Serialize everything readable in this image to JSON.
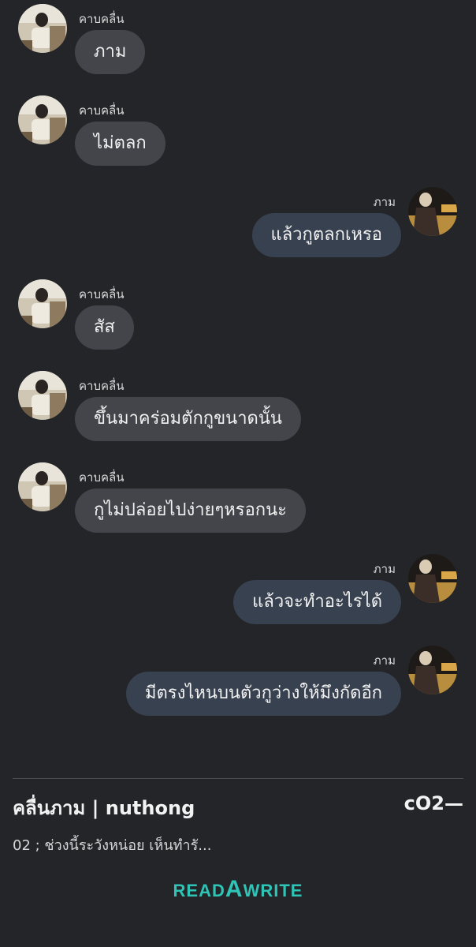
{
  "conversation": {
    "messages": [
      {
        "side": "left",
        "sender": "คาบคลื่น",
        "text": "ภาม"
      },
      {
        "side": "left",
        "sender": "คาบคลื่น",
        "text": "ไม่ตลก"
      },
      {
        "side": "right",
        "sender": "ภาม",
        "text": "แล้วกูตลกเหรอ"
      },
      {
        "side": "left",
        "sender": "คาบคลื่น",
        "text": "สัส"
      },
      {
        "side": "left",
        "sender": "คาบคลื่น",
        "text": "ขึ้นมาคร่อมตักกูขนาดนั้น"
      },
      {
        "side": "left",
        "sender": "คาบคลื่น",
        "text": "กูไม่ปล่อยไปง่ายๆหรอกนะ"
      },
      {
        "side": "right",
        "sender": "ภาม",
        "text": "แล้วจะทำอะไรได้"
      },
      {
        "side": "right",
        "sender": "ภาม",
        "text": "มีตรงไหนบนตัวกูว่างให้มึงกัดอีก"
      }
    ]
  },
  "footer": {
    "story_title": "คลื่นภาม | nuthong",
    "chapter_code": "cO2—",
    "chapter_title": "02 ; ช่วงนี้ระวังหน่อย เห็นทำรั...",
    "logo_pre": "READ",
    "logo_big": "A",
    "logo_post": "WRITE"
  },
  "colors": {
    "background": "#232529",
    "bubble_left": "#43454b",
    "bubble_right": "#38414f",
    "logo": "#2ec4b6"
  }
}
